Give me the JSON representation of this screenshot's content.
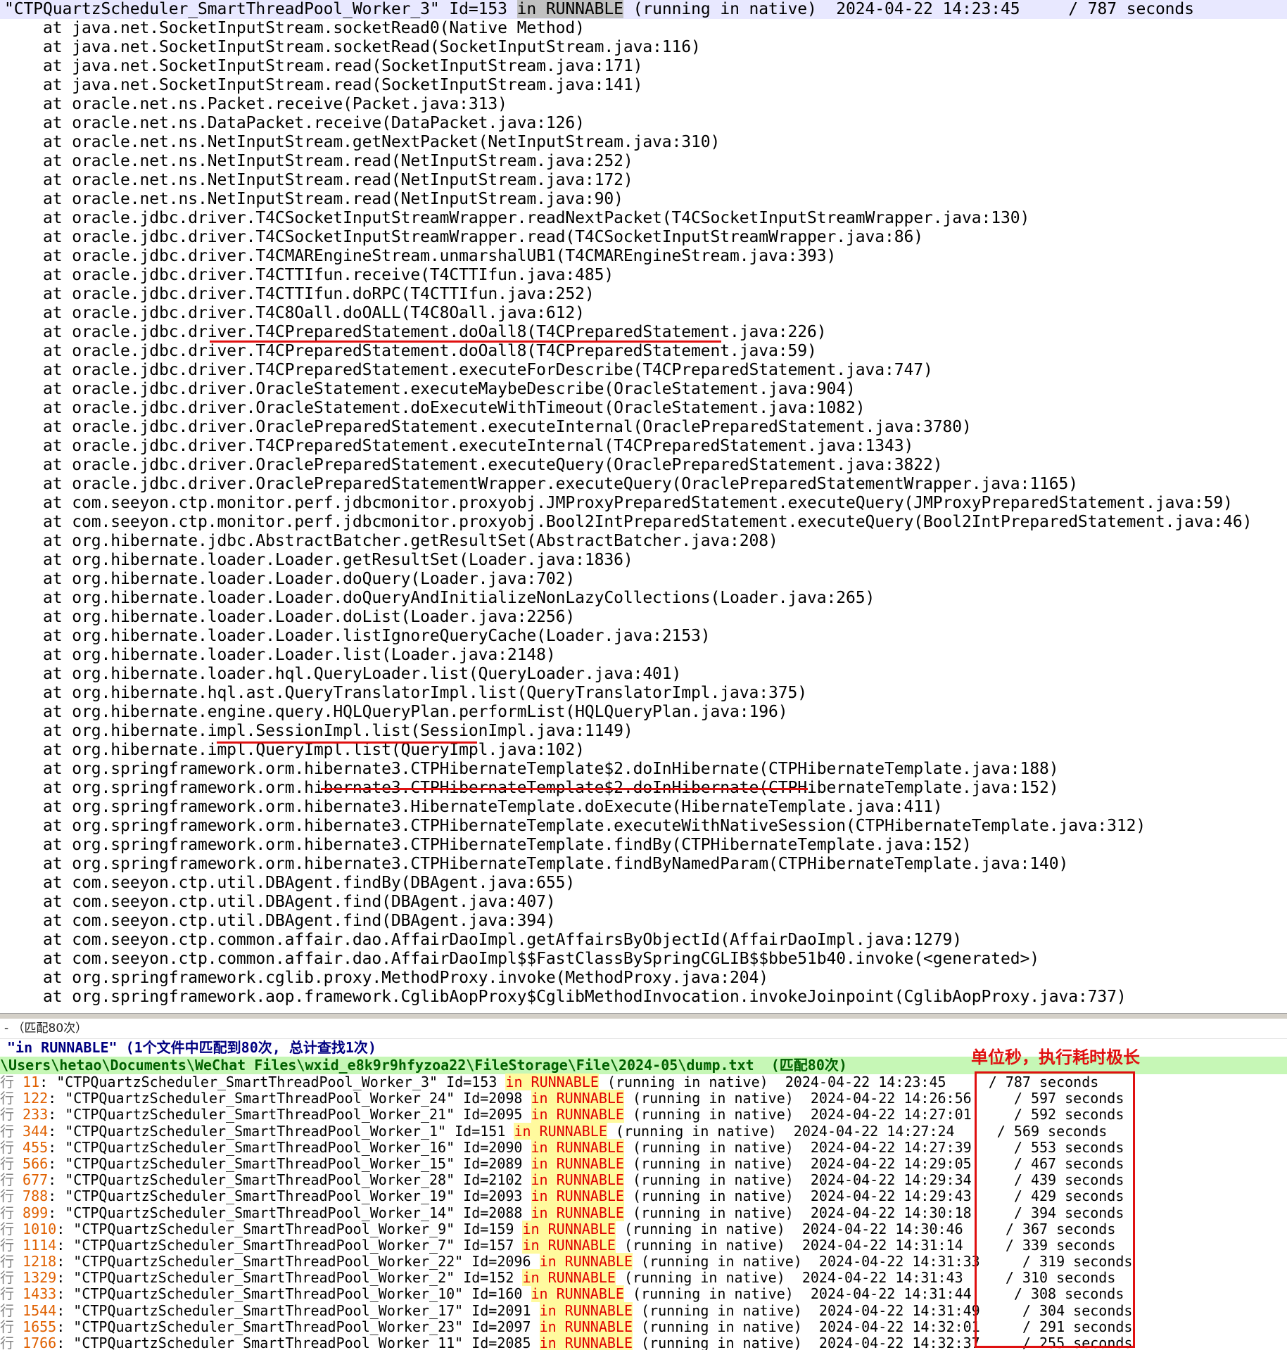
{
  "editor": {
    "header": {
      "pre": "\"CTPQuartzScheduler_SmartThreadPool_Worker_3\" Id=153 ",
      "mark": "in RUNNABLE",
      "post": " (running in native)  2024-04-22 14:23:45     / 787 seconds"
    },
    "lines": [
      "    at java.net.SocketInputStream.socketRead0(Native Method)",
      "    at java.net.SocketInputStream.socketRead(SocketInputStream.java:116)",
      "    at java.net.SocketInputStream.read(SocketInputStream.java:171)",
      "    at java.net.SocketInputStream.read(SocketInputStream.java:141)",
      "    at oracle.net.ns.Packet.receive(Packet.java:313)",
      "    at oracle.net.ns.DataPacket.receive(DataPacket.java:126)",
      "    at oracle.net.ns.NetInputStream.getNextPacket(NetInputStream.java:310)",
      "    at oracle.net.ns.NetInputStream.read(NetInputStream.java:252)",
      "    at oracle.net.ns.NetInputStream.read(NetInputStream.java:172)",
      "    at oracle.net.ns.NetInputStream.read(NetInputStream.java:90)",
      "    at oracle.jdbc.driver.T4CSocketInputStreamWrapper.readNextPacket(T4CSocketInputStreamWrapper.java:130)",
      "    at oracle.jdbc.driver.T4CSocketInputStreamWrapper.read(T4CSocketInputStreamWrapper.java:86)",
      "    at oracle.jdbc.driver.T4CMAREngineStream.unmarshalUB1(T4CMAREngineStream.java:393)",
      "    at oracle.jdbc.driver.T4CTTIfun.receive(T4CTTIfun.java:485)",
      "    at oracle.jdbc.driver.T4CTTIfun.doRPC(T4CTTIfun.java:252)",
      "    at oracle.jdbc.driver.T4C8Oall.doOALL(T4C8Oall.java:612)",
      "    at oracle.jdbc.driver.T4CPreparedStatement.doOall8(T4CPreparedStatement.java:226)",
      "    at oracle.jdbc.driver.T4CPreparedStatement.doOall8(T4CPreparedStatement.java:59)",
      "    at oracle.jdbc.driver.T4CPreparedStatement.executeForDescribe(T4CPreparedStatement.java:747)",
      "    at oracle.jdbc.driver.OracleStatement.executeMaybeDescribe(OracleStatement.java:904)",
      "    at oracle.jdbc.driver.OracleStatement.doExecuteWithTimeout(OracleStatement.java:1082)",
      "    at oracle.jdbc.driver.OraclePreparedStatement.executeInternal(OraclePreparedStatement.java:3780)",
      "    at oracle.jdbc.driver.T4CPreparedStatement.executeInternal(T4CPreparedStatement.java:1343)",
      "    at oracle.jdbc.driver.OraclePreparedStatement.executeQuery(OraclePreparedStatement.java:3822)",
      "    at oracle.jdbc.driver.OraclePreparedStatementWrapper.executeQuery(OraclePreparedStatementWrapper.java:1165)",
      "    at com.seeyon.ctp.monitor.perf.jdbcmonitor.proxyobj.JMProxyPreparedStatement.executeQuery(JMProxyPreparedStatement.java:59)",
      "    at com.seeyon.ctp.monitor.perf.jdbcmonitor.proxyobj.Bool2IntPreparedStatement.executeQuery(Bool2IntPreparedStatement.java:46)",
      "    at org.hibernate.jdbc.AbstractBatcher.getResultSet(AbstractBatcher.java:208)",
      "    at org.hibernate.loader.Loader.getResultSet(Loader.java:1836)",
      "    at org.hibernate.loader.Loader.doQuery(Loader.java:702)",
      "    at org.hibernate.loader.Loader.doQueryAndInitializeNonLazyCollections(Loader.java:265)",
      "    at org.hibernate.loader.Loader.doList(Loader.java:2256)",
      "    at org.hibernate.loader.Loader.listIgnoreQueryCache(Loader.java:2153)",
      "    at org.hibernate.loader.Loader.list(Loader.java:2148)",
      "    at org.hibernate.loader.hql.QueryLoader.list(QueryLoader.java:401)",
      "    at org.hibernate.hql.ast.QueryTranslatorImpl.list(QueryTranslatorImpl.java:375)",
      "    at org.hibernate.engine.query.HQLQueryPlan.performList(HQLQueryPlan.java:196)",
      "    at org.hibernate.impl.SessionImpl.list(SessionImpl.java:1149)",
      "    at org.hibernate.impl.QueryImpl.list(QueryImpl.java:102)",
      "    at org.springframework.orm.hibernate3.CTPHibernateTemplate$2.doInHibernate(CTPHibernateTemplate.java:188)",
      "    at org.springframework.orm.hibernate3.CTPHibernateTemplate$2.doInHibernate(CTPHibernateTemplate.java:152)",
      "    at org.springframework.orm.hibernate3.HibernateTemplate.doExecute(HibernateTemplate.java:411)",
      "    at org.springframework.orm.hibernate3.CTPHibernateTemplate.executeWithNativeSession(CTPHibernateTemplate.java:312)",
      "    at org.springframework.orm.hibernate3.CTPHibernateTemplate.findBy(CTPHibernateTemplate.java:152)",
      "    at org.springframework.orm.hibernate3.CTPHibernateTemplate.findByNamedParam(CTPHibernateTemplate.java:140)",
      "    at com.seeyon.ctp.util.DBAgent.findBy(DBAgent.java:655)",
      "    at com.seeyon.ctp.util.DBAgent.find(DBAgent.java:407)",
      "    at com.seeyon.ctp.util.DBAgent.find(DBAgent.java:394)",
      "    at com.seeyon.ctp.common.affair.dao.AffairDaoImpl.getAffairsByObjectId(AffairDaoImpl.java:1279)",
      "    at com.seeyon.ctp.common.affair.dao.AffairDaoImpl$$FastClassBySpringCGLIB$$bbe51b40.invoke(<generated>)",
      "    at org.springframework.cglib.proxy.MethodProxy.invoke(MethodProxy.java:204)",
      "    at org.springframework.aop.framework.CglibAopProxy$CglibMethodInvocation.invokeJoinpoint(CglibAopProxy.java:737)"
    ]
  },
  "results": {
    "panel_title": "- （匹配80次）",
    "summary": "\"in RUNNABLE\" (1个文件中匹配到80次, 总计查找1次)",
    "file_path": "\\Users\\hetao\\Documents\\WeChat Files\\wxid_e8k9r9hfyzoa22\\FileStorage\\File\\2024-05\\dump.txt  (匹配80次)",
    "annotation": "单位秒，执行耗时极长",
    "rows": [
      {
        "prefix": "行 ",
        "line": "11",
        "pre": ": \"CTPQuartzScheduler_SmartThreadPool_Worker_3\" Id=153 ",
        "hl": "in RUNNABLE",
        "post": " (running in native)  2024-04-22 14:23:45     / 787 seconds"
      },
      {
        "prefix": "行 ",
        "line": "122",
        "pre": ": \"CTPQuartzScheduler_SmartThreadPool_Worker_24\" Id=2098 ",
        "hl": "in RUNNABLE",
        "post": " (running in native)  2024-04-22 14:26:56     / 597 seconds"
      },
      {
        "prefix": "行 ",
        "line": "233",
        "pre": ": \"CTPQuartzScheduler_SmartThreadPool_Worker_21\" Id=2095 ",
        "hl": "in RUNNABLE",
        "post": " (running in native)  2024-04-22 14:27:01     / 592 seconds"
      },
      {
        "prefix": "行 ",
        "line": "344",
        "pre": ": \"CTPQuartzScheduler_SmartThreadPool_Worker_1\" Id=151 ",
        "hl": "in RUNNABLE",
        "post": " (running in native)  2024-04-22 14:27:24     / 569 seconds"
      },
      {
        "prefix": "行 ",
        "line": "455",
        "pre": ": \"CTPQuartzScheduler_SmartThreadPool_Worker_16\" Id=2090 ",
        "hl": "in RUNNABLE",
        "post": " (running in native)  2024-04-22 14:27:39     / 553 seconds"
      },
      {
        "prefix": "行 ",
        "line": "566",
        "pre": ": \"CTPQuartzScheduler_SmartThreadPool_Worker_15\" Id=2089 ",
        "hl": "in RUNNABLE",
        "post": " (running in native)  2024-04-22 14:29:05     / 467 seconds"
      },
      {
        "prefix": "行 ",
        "line": "677",
        "pre": ": \"CTPQuartzScheduler_SmartThreadPool_Worker_28\" Id=2102 ",
        "hl": "in RUNNABLE",
        "post": " (running in native)  2024-04-22 14:29:34     / 439 seconds"
      },
      {
        "prefix": "行 ",
        "line": "788",
        "pre": ": \"CTPQuartzScheduler_SmartThreadPool_Worker_19\" Id=2093 ",
        "hl": "in RUNNABLE",
        "post": " (running in native)  2024-04-22 14:29:43     / 429 seconds"
      },
      {
        "prefix": "行 ",
        "line": "899",
        "pre": ": \"CTPQuartzScheduler_SmartThreadPool_Worker_14\" Id=2088 ",
        "hl": "in RUNNABLE",
        "post": " (running in native)  2024-04-22 14:30:18     / 394 seconds"
      },
      {
        "prefix": "行 ",
        "line": "1010",
        "pre": ": \"CTPQuartzScheduler_SmartThreadPool_Worker_9\" Id=159 ",
        "hl": "in RUNNABLE",
        "post": " (running in native)  2024-04-22 14:30:46     / 367 seconds"
      },
      {
        "prefix": "行 ",
        "line": "1114",
        "pre": ": \"CTPQuartzScheduler_SmartThreadPool_Worker_7\" Id=157 ",
        "hl": "in RUNNABLE",
        "post": " (running in native)  2024-04-22 14:31:14     / 339 seconds"
      },
      {
        "prefix": "行 ",
        "line": "1218",
        "pre": ": \"CTPQuartzScheduler_SmartThreadPool_Worker_22\" Id=2096 ",
        "hl": "in RUNNABLE",
        "post": " (running in native)  2024-04-22 14:31:33     / 319 seconds"
      },
      {
        "prefix": "行 ",
        "line": "1329",
        "pre": ": \"CTPQuartzScheduler_SmartThreadPool_Worker_2\" Id=152 ",
        "hl": "in RUNNABLE",
        "post": " (running in native)  2024-04-22 14:31:43     / 310 seconds"
      },
      {
        "prefix": "行 ",
        "line": "1433",
        "pre": ": \"CTPQuartzScheduler_SmartThreadPool_Worker_10\" Id=160 ",
        "hl": "in RUNNABLE",
        "post": " (running in native)  2024-04-22 14:31:44     / 308 seconds"
      },
      {
        "prefix": "行 ",
        "line": "1544",
        "pre": ": \"CTPQuartzScheduler_SmartThreadPool_Worker_17\" Id=2091 ",
        "hl": "in RUNNABLE",
        "post": " (running in native)  2024-04-22 14:31:49     / 304 seconds"
      },
      {
        "prefix": "行 ",
        "line": "1655",
        "pre": ": \"CTPQuartzScheduler_SmartThreadPool_Worker_23\" Id=2097 ",
        "hl": "in RUNNABLE",
        "post": " (running in native)  2024-04-22 14:32:01     / 291 seconds"
      },
      {
        "prefix": "行 ",
        "line": "1766",
        "pre": ": \"CTPQuartzScheduler_SmartThreadPool_Worker_11\" Id=2085 ",
        "hl": "in RUNNABLE",
        "post": " (running in native)  2024-04-22 14:32:37     / 255 seconds"
      }
    ]
  },
  "colors": {
    "annotation_red": "#e01010",
    "highlight_text": "#e00000",
    "highlight_bg": "#fffa9e",
    "file_row_bg": "#c6f7b6"
  }
}
